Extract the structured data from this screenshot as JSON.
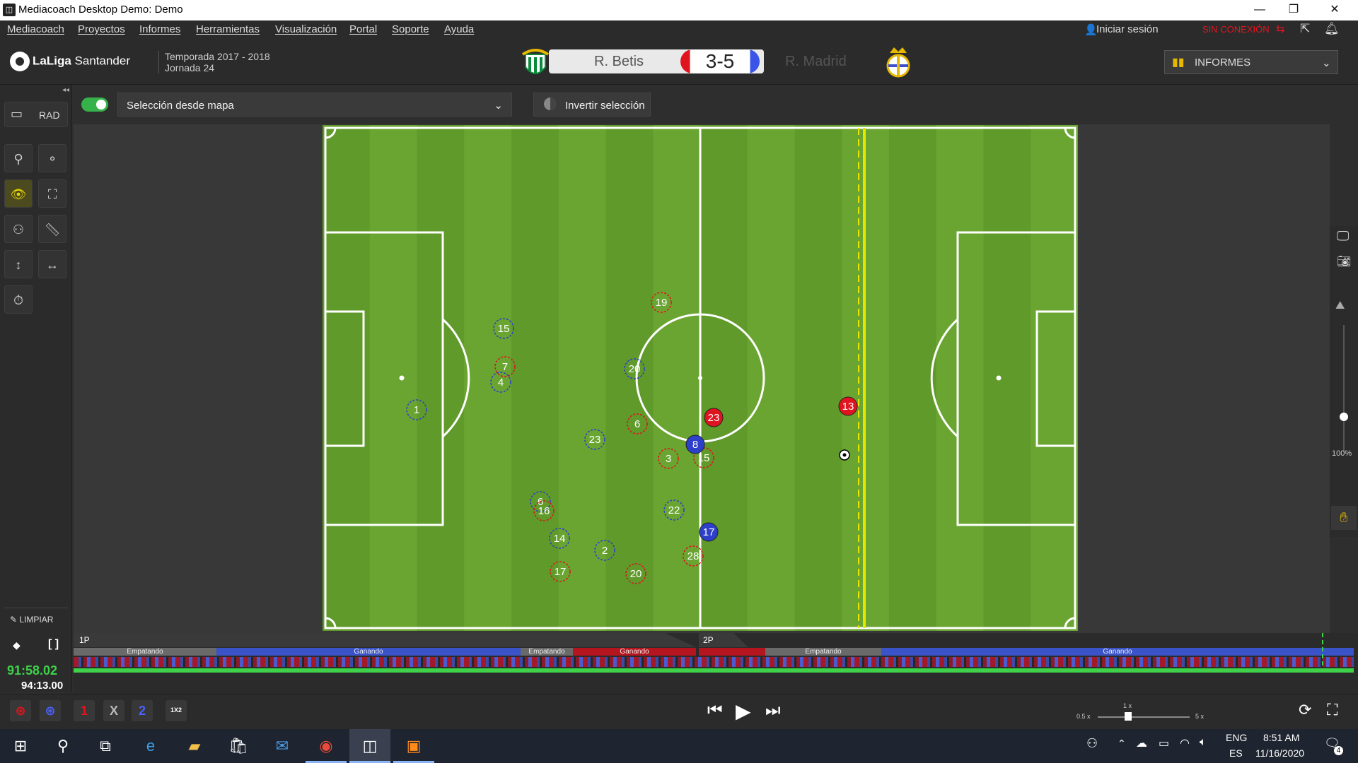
{
  "window": {
    "title": "Mediacoach Desktop Demo: Demo",
    "app_icon": "mediacoach-icon"
  },
  "menu": {
    "items": [
      "Mediacoach",
      "Proyectos",
      "Informes",
      "Herramientas",
      "Visualización",
      "Portal",
      "Soporte",
      "Ayuda"
    ],
    "login": "Iniciar sesión",
    "status": "SIN CONEXIÓN",
    "status_color": "#e0141e"
  },
  "header": {
    "league": "LaLiga",
    "sponsor": "Santander",
    "season": "Temporada 2017 - 2018",
    "round": "Jornada 24",
    "home_team": "R. Betis",
    "away_team": "R. Madrid",
    "score": "3-5",
    "home_color": "#e0141e",
    "away_color": "#3a53e8",
    "reports_label": "INFORMES"
  },
  "toolbar": {
    "rad_label": "RAD",
    "clear_label": "LIMPIAR"
  },
  "selection": {
    "dropdown_value": "Selección desde mapa",
    "invert_label": "Invertir selección",
    "toggle_on": true
  },
  "zoom": {
    "label": "100%"
  },
  "pitch": {
    "grass_colors": [
      "#5f9a2a",
      "#6aa531"
    ],
    "red_team_color": "#e0141e",
    "blue_team_color": "#2e3fc9",
    "players": [
      {
        "team": "blue",
        "number": "1",
        "state": "ghost"
      },
      {
        "team": "blue",
        "number": "15",
        "state": "ghost"
      },
      {
        "team": "red",
        "number": "7",
        "state": "ghost"
      },
      {
        "team": "blue",
        "number": "4",
        "state": "ghost"
      },
      {
        "team": "red",
        "number": "19",
        "state": "ghost"
      },
      {
        "team": "blue",
        "number": "20",
        "state": "ghost"
      },
      {
        "team": "red",
        "number": "6",
        "state": "ghost"
      },
      {
        "team": "blue",
        "number": "23",
        "state": "ghost"
      },
      {
        "team": "red",
        "number": "3",
        "state": "ghost"
      },
      {
        "team": "red",
        "number": "15",
        "state": "ghost"
      },
      {
        "team": "blue",
        "number": "8",
        "state": "active"
      },
      {
        "team": "red",
        "number": "23",
        "state": "active"
      },
      {
        "team": "red",
        "number": "13",
        "state": "active"
      },
      {
        "team": "blue",
        "number": "6",
        "state": "ghost"
      },
      {
        "team": "red",
        "number": "16",
        "state": "ghost"
      },
      {
        "team": "blue",
        "number": "22",
        "state": "ghost"
      },
      {
        "team": "blue",
        "number": "17",
        "state": "active"
      },
      {
        "team": "blue",
        "number": "14",
        "state": "ghost"
      },
      {
        "team": "blue",
        "number": "2",
        "state": "ghost"
      },
      {
        "team": "red",
        "number": "28",
        "state": "ghost"
      },
      {
        "team": "red",
        "number": "17",
        "state": "ghost"
      },
      {
        "team": "red",
        "number": "20",
        "state": "ghost"
      }
    ]
  },
  "timeline": {
    "half1": "1P",
    "half2": "2P",
    "segments_1p": [
      {
        "label": "Empatando",
        "state": "draw"
      },
      {
        "label": "Ganando",
        "state": "blue"
      },
      {
        "label": "Empatando",
        "state": "draw"
      },
      {
        "label": "Ganando",
        "state": "red"
      }
    ],
    "segments_2p": [
      {
        "label": "",
        "state": "red"
      },
      {
        "label": "Empatando",
        "state": "draw"
      },
      {
        "label": "Ganando",
        "state": "blue"
      }
    ],
    "current_time": "91:58.02",
    "total_time": "94:13.00"
  },
  "playback": {
    "btn_1": "1",
    "btn_x": "X",
    "btn_2": "2",
    "btn_1x2": "1X2",
    "speed_min": "0.5 x",
    "speed_mid": "1 x",
    "speed_max": "5 x"
  },
  "taskbar": {
    "lang1": "ENG",
    "lang2": "ES",
    "time": "8:51 AM",
    "date": "11/16/2020",
    "notif": "4"
  }
}
